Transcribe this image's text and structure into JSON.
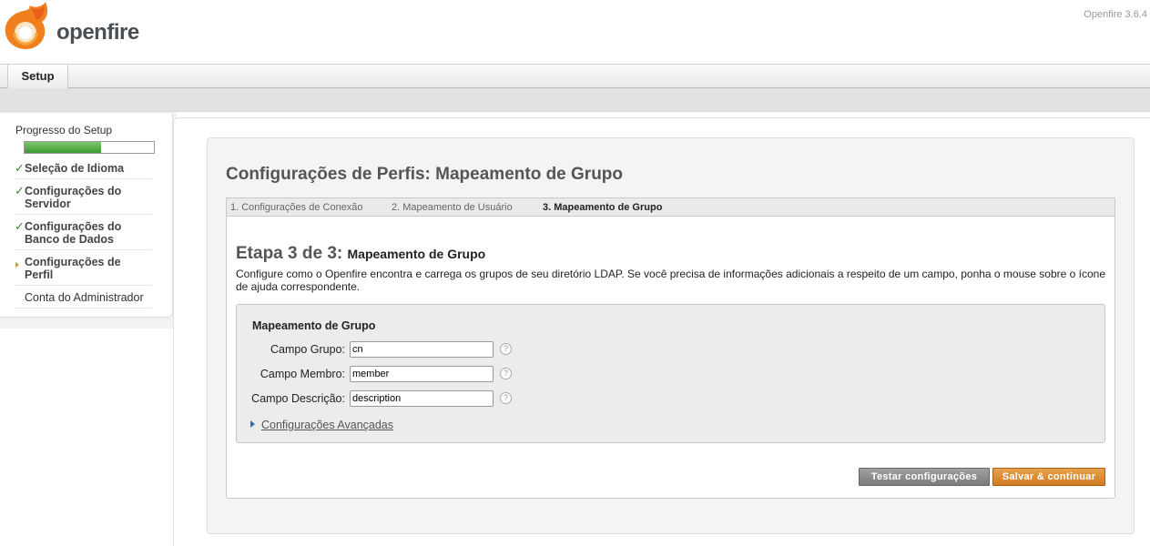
{
  "header": {
    "logo_text": "openfire",
    "version": "Openfire 3.6.4"
  },
  "nav": {
    "tabs": [
      {
        "label": "Setup"
      }
    ]
  },
  "sidebar": {
    "progress_title": "Progresso do Setup",
    "progress_fraction": 0.59,
    "steps": [
      {
        "label": "Seleção de Idioma",
        "status": "done"
      },
      {
        "label": "Configurações do Servidor",
        "status": "done"
      },
      {
        "label": "Configurações do Banco de Dados",
        "status": "done"
      },
      {
        "label": "Configurações de Perfil",
        "status": "current"
      },
      {
        "label": "Conta do Administrador",
        "status": "todo"
      }
    ]
  },
  "main": {
    "title": "Configurações de Perfis: Mapeamento de Grupo",
    "tabs": [
      {
        "label": "1. Configurações de Conexão",
        "active": false
      },
      {
        "label": "2. Mapeamento de Usuário",
        "active": false
      },
      {
        "label": "3. Mapeamento de Grupo",
        "active": true
      }
    ],
    "step_heading": "Etapa 3 de 3:",
    "step_subheading": "Mapeamento de Grupo",
    "description": "Configure como o Openfire encontra e carrega os grupos de seu diretório LDAP. Se você precisa de informações adicionais a respeito de um campo, ponha o mouse sobre o ícone de ajuda correspondente.",
    "mapping": {
      "title": "Mapeamento de Grupo",
      "fields": [
        {
          "label": "Campo Grupo:",
          "value": "cn"
        },
        {
          "label": "Campo Membro:",
          "value": "member"
        },
        {
          "label": "Campo Descrição:",
          "value": "description"
        }
      ],
      "help_glyph": "?",
      "advanced_label": "Configurações Avançadas"
    },
    "buttons": {
      "test": "Testar configurações",
      "save": "Salvar & continuar"
    }
  },
  "colors": {
    "accent_orange": "#cf7a1f",
    "progress_green": "#3c9a2e",
    "check_green": "#3a8f2c"
  }
}
